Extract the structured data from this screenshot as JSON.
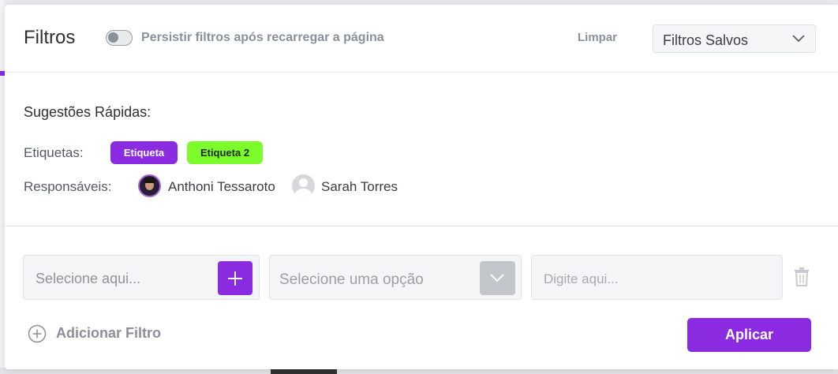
{
  "header": {
    "title": "Filtros",
    "persist_toggle": {
      "label": "Persistir filtros após recarregar a página",
      "checked": false
    },
    "clear_label": "Limpar",
    "saved_filters": {
      "selected": "Filtros Salvos"
    }
  },
  "suggestions": {
    "title": "Sugestões Rápidas:",
    "tags_label": "Etiquetas:",
    "tags": [
      {
        "label": "Etiqueta",
        "color": "#8a2be2"
      },
      {
        "label": "Etiqueta 2",
        "color": "#7cfc2a"
      }
    ],
    "assignees_label": "Responsáveis:",
    "assignees": [
      {
        "name": "Anthoni Tessaroto",
        "avatar": "photo"
      },
      {
        "name": "Sarah Torres",
        "avatar": "default-user-icon"
      }
    ]
  },
  "filter_row": {
    "field_placeholder": "Selecione aqui...",
    "operator_placeholder": "Selecione uma opção",
    "value_placeholder": "Digite aqui..."
  },
  "footer": {
    "add_filter_label": "Adicionar Filtro",
    "apply_label": "Aplicar"
  },
  "colors": {
    "accent": "#8a2be2",
    "tag_green": "#7cfc2a"
  }
}
